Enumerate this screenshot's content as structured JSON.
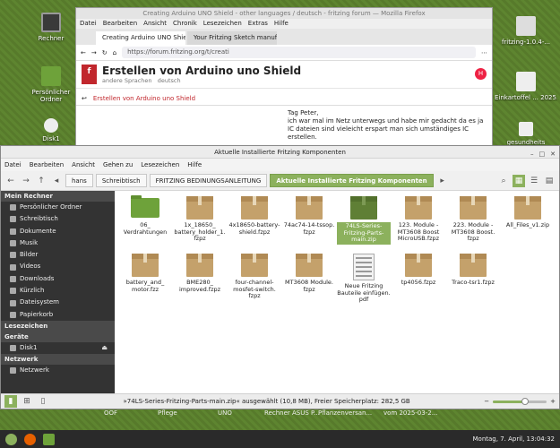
{
  "desktop": {
    "icons": [
      {
        "label": "Rechner"
      },
      {
        "label": "Persönlicher\nOrdner"
      },
      {
        "label": "Disk1"
      }
    ],
    "right_icons": [
      {
        "label": "fritzing-1.0.4-..."
      },
      {
        "label": "Einkartoffel ... 2025.pdf"
      },
      {
        "label": "gesundheits"
      }
    ],
    "behind_labels": [
      "OOF",
      "Pflege",
      "UNO",
      "Rechner ASUS P...",
      "Pflanzenversan...",
      "vom 2025-03-2..."
    ]
  },
  "firefox": {
    "title": "Creating Arduino UNO Shield - other languages / deutsch - fritzing forum — Mozilla Firefox",
    "menu": [
      "Datei",
      "Bearbeiten",
      "Ansicht",
      "Chronik",
      "Lesezeichen",
      "Extras",
      "Hilfe"
    ],
    "tabs": [
      {
        "label": "Creating Arduino UNO Shie"
      },
      {
        "label": "Your Fritzing Sketch manuf"
      }
    ],
    "url": "https://forum.fritzing.org/t/creati",
    "forum_title": "Erstellen von Arduino uno Shield",
    "forum_sub1": "andere Sprachen",
    "forum_sub2": "deutsch",
    "avatar": "H",
    "reply_title": "Erstellen von Arduino uno Shield",
    "post_text": "Tag Peter,\nich war mal im Netz unterwegs und habe mir gedacht da es ja IC dateien sind vieleicht erspart man sich umständiges IC erstellen."
  },
  "filemanager": {
    "title": "Aktuelle Installierte Fritzing Komponenten",
    "menu": [
      "Datei",
      "Bearbeiten",
      "Ansicht",
      "Gehen zu",
      "Lesezeichen",
      "Hilfe"
    ],
    "crumbs": [
      "hans",
      "Schreibtisch",
      "FRITZING BEDINUNGSANLEITUNG",
      "Aktuelle Installierte Fritzing Komponenten"
    ],
    "sidebar": {
      "sections": [
        {
          "title": "Mein Rechner",
          "items": [
            "Persönlicher Ordner",
            "Schreibtisch",
            "Dokumente",
            "Musik",
            "Bilder",
            "Videos",
            "Downloads",
            "Kürzlich",
            "Dateisystem",
            "Papierkorb"
          ]
        },
        {
          "title": "Lesezeichen",
          "items": []
        },
        {
          "title": "Geräte",
          "items": [
            "Disk1"
          ]
        },
        {
          "title": "Netzwerk",
          "items": [
            "Netzwerk"
          ]
        }
      ]
    },
    "files": [
      {
        "name": "06_ Verdrahtungen",
        "kind": "folder"
      },
      {
        "name": "1x_18650_ battery_holder_1. fzpz",
        "kind": "box"
      },
      {
        "name": "4x18650-battery- shield.fzpz",
        "kind": "box"
      },
      {
        "name": "74ac74-14-tssop. fzpz",
        "kind": "box"
      },
      {
        "name": "74LS-Series- Fritzing-Parts- main.zip",
        "kind": "box",
        "selected": true
      },
      {
        "name": "123. Module - MT3608 Boost MicroUSB.fzpz",
        "kind": "box"
      },
      {
        "name": "223. Module - MT3608 Boost. fzpz",
        "kind": "box"
      },
      {
        "name": "All_Files_v1.zip",
        "kind": "box"
      },
      {
        "name": "battery_and_ motor.fzz",
        "kind": "box"
      },
      {
        "name": "BME280_ improved.fzpz",
        "kind": "box"
      },
      {
        "name": "four-channel- mosfet-switch. fzpz",
        "kind": "box"
      },
      {
        "name": "MT3608 Module. fzpz",
        "kind": "box"
      },
      {
        "name": "Neue Fritzing Bauteile einfügen. pdf",
        "kind": "pdf"
      },
      {
        "name": "tp4056.fzpz",
        "kind": "box"
      },
      {
        "name": "Traco-tsr1.fzpz",
        "kind": "box"
      }
    ],
    "status": "»74LS-Series-Fritzing-Parts-main.zip« ausgewählt (10,8 MB), Freier Speicherplatz: 282,5 GB",
    "zoom_level": 0.6
  },
  "taskbar": {
    "clock": "Montag, 7. April, 13:04:32"
  },
  "colors": {
    "accent": "#8cb15d",
    "sidebar_bg": "#333333",
    "desktop": "#5a7d2e"
  }
}
